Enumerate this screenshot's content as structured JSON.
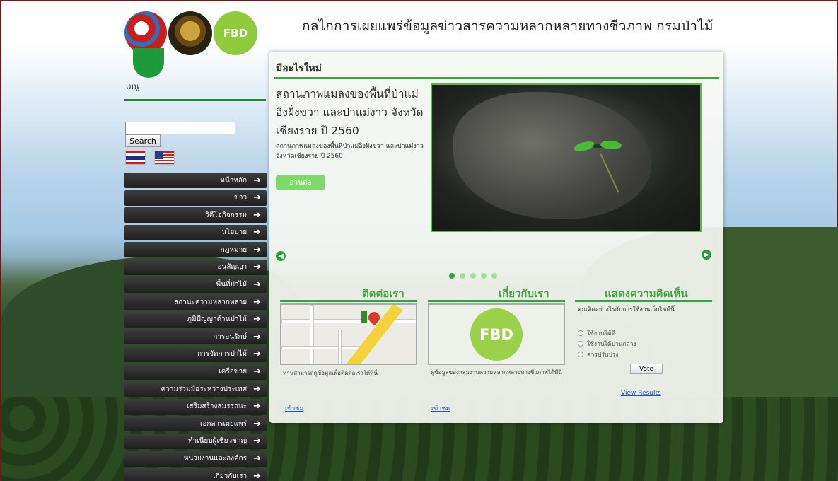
{
  "header": {
    "site_title": "กลไกการเผยแพร่ข้อมูลข่าวสารความหลากหลายทางชีวภาพ กรมป่าไม้",
    "logos": [
      "globe-logo",
      "royal-seal-logo",
      "fbd-logo"
    ],
    "fbd_logo_text": "FBD"
  },
  "sidebar": {
    "menu_label": "เมนู",
    "search": {
      "value": "",
      "button_label": "Search"
    },
    "languages": [
      "thai-flag-icon",
      "us-flag-icon"
    ],
    "items": [
      {
        "label": "หน้าหลัก"
      },
      {
        "label": "ข่าว"
      },
      {
        "label": "วิดีโอกิจกรรม"
      },
      {
        "label": "นโยบาย"
      },
      {
        "label": "กฎหมาย"
      },
      {
        "label": "อนุสัญญา"
      },
      {
        "label": "พื้นที่ป่าไม้"
      },
      {
        "label": "สถานะความหลากหลาย"
      },
      {
        "label": "ภูมิปัญญาด้านป่าไม้"
      },
      {
        "label": "การอนุรักษ์"
      },
      {
        "label": "การจัดการป่าไม้"
      },
      {
        "label": "เครือข่าย"
      },
      {
        "label": "ความร่วมมือระหว่างประเทศ"
      },
      {
        "label": "เสริมสร้างสมรรถนะ"
      },
      {
        "label": "เอกสารเผยแพร่"
      },
      {
        "label": "ทำเนียบผู้เชี่ยวชาญ"
      },
      {
        "label": "หน่วยงานและองค์กร"
      },
      {
        "label": "เกี่ยวกับเรา"
      }
    ]
  },
  "main": {
    "section_title": "มีอะไรใหม่",
    "slide": {
      "headline": "สถานภาพแมลงของพื้นที่ป่าแม่อิงฝั่งขวา และป่าแม่งาว จังหวัดเชียงราย ปี 2560",
      "description": "สถานภาพแมลงของพื้นที่ป่าแม่อิงฝั่งขวา และป่าแม่งาว จังหวัดเชียงราย ปี 2560",
      "read_more": "อ่านต่อ"
    },
    "slider_dots": 5,
    "active_dot": 1,
    "boxes": {
      "contact": {
        "title": "ติดต่อเรา",
        "text": "ท่านสามารถดูข้อมูลเพื่อติดต่อเราได้ที่นี่",
        "link": "เข้าชม"
      },
      "about": {
        "title": "เกี่ยวกับเรา",
        "text": "ดูข้อมูลของกลุ่มงานความหลากหลายทางชีวภาพได้ที่นี่",
        "link": "เข้าชม"
      },
      "comment": {
        "title": "แสดงความคิดเห็น",
        "question": "คุณคิดอย่างไรกับการใช้งานเว็บไซต์นี้",
        "options": [
          "ใช้งานได้ดี",
          "ใช้งานได้ปานกลาง",
          "ควรปรับปรุง"
        ],
        "vote_label": "Vote",
        "results_label": "View Results"
      }
    }
  }
}
